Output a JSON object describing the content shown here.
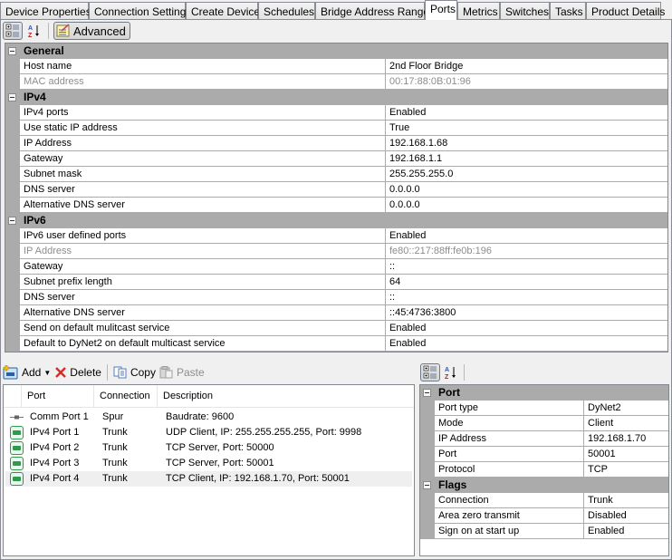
{
  "tabs": [
    {
      "label": "Device Properties",
      "active": false
    },
    {
      "label": "Connection Settings",
      "active": false
    },
    {
      "label": "Create Device",
      "active": false
    },
    {
      "label": "Schedules",
      "active": false
    },
    {
      "label": "Bridge Address Ranges",
      "active": false
    },
    {
      "label": "Ports",
      "active": true
    },
    {
      "label": "Metrics",
      "active": false
    },
    {
      "label": "Switches",
      "active": false
    },
    {
      "label": "Tasks",
      "active": false
    },
    {
      "label": "Product Details",
      "active": false
    }
  ],
  "top_toolbar": {
    "categorized_icon": "categorized-view-icon",
    "alphabetical_icon": "sort-az-icon",
    "advanced_label": "Advanced",
    "advanced_icon": "notepad-edit-icon",
    "advanced_pressed": true
  },
  "property_grid": {
    "categories": [
      {
        "name": "General",
        "properties": [
          {
            "name": "Host name",
            "value": "2nd Floor Bridge",
            "readonly": false
          },
          {
            "name": "MAC address",
            "value": "00:17:88:0B:01:96",
            "readonly": true
          }
        ]
      },
      {
        "name": "IPv4",
        "properties": [
          {
            "name": "IPv4 ports",
            "value": "Enabled",
            "readonly": false
          },
          {
            "name": "Use static IP address",
            "value": "True",
            "readonly": false
          },
          {
            "name": "IP Address",
            "value": "192.168.1.68",
            "readonly": false
          },
          {
            "name": "Gateway",
            "value": "192.168.1.1",
            "readonly": false
          },
          {
            "name": "Subnet mask",
            "value": "255.255.255.0",
            "readonly": false
          },
          {
            "name": "DNS server",
            "value": "0.0.0.0",
            "readonly": false
          },
          {
            "name": "Alternative DNS server",
            "value": "0.0.0.0",
            "readonly": false
          }
        ]
      },
      {
        "name": "IPv6",
        "properties": [
          {
            "name": "IPv6 user defined ports",
            "value": "Enabled",
            "readonly": false
          },
          {
            "name": "IP Address",
            "value": "fe80::217:88ff:fe0b:196",
            "readonly": true
          },
          {
            "name": "Gateway",
            "value": "::",
            "readonly": false
          },
          {
            "name": "Subnet prefix length",
            "value": "64",
            "readonly": false
          },
          {
            "name": "DNS server",
            "value": "::",
            "readonly": false
          },
          {
            "name": "Alternative DNS server",
            "value": "::45:4736:3800",
            "readonly": false
          },
          {
            "name": "Send on default mulitcast service",
            "value": "Enabled",
            "readonly": false
          },
          {
            "name": "Default to DyNet2 on default multicast service",
            "value": "Enabled",
            "readonly": false
          }
        ]
      }
    ]
  },
  "ports_toolbar": {
    "add_label": "Add",
    "delete_label": "Delete",
    "copy_label": "Copy",
    "paste_label": "Paste",
    "paste_disabled": true
  },
  "ports_list": {
    "columns": [
      "Port",
      "Connection",
      "Description"
    ],
    "rows": [
      {
        "icon": "serial-port-icon",
        "port": "Comm Port 1",
        "connection": "Spur",
        "description": "Baudrate: 9600",
        "selected": false
      },
      {
        "icon": "network-port-icon",
        "port": "IPv4 Port 1",
        "connection": "Trunk",
        "description": "UDP Client, IP: 255.255.255.255, Port: 9998",
        "selected": false
      },
      {
        "icon": "network-port-icon",
        "port": "IPv4 Port 2",
        "connection": "Trunk",
        "description": "TCP Server, Port: 50000",
        "selected": false
      },
      {
        "icon": "network-port-icon",
        "port": "IPv4 Port 3",
        "connection": "Trunk",
        "description": "TCP Server, Port: 50001",
        "selected": false
      },
      {
        "icon": "network-port-icon",
        "port": "IPv4 Port 4",
        "connection": "Trunk",
        "description": "TCP Client, IP: 192.168.1.70, Port: 50001",
        "selected": true
      }
    ]
  },
  "port_properties": {
    "categories": [
      {
        "name": "Port",
        "properties": [
          {
            "name": "Port type",
            "value": "DyNet2"
          },
          {
            "name": "Mode",
            "value": "Client"
          },
          {
            "name": "IP Address",
            "value": "192.168.1.70"
          },
          {
            "name": "Port",
            "value": "50001"
          },
          {
            "name": "Protocol",
            "value": "TCP"
          }
        ]
      },
      {
        "name": "Flags",
        "properties": [
          {
            "name": "Connection",
            "value": "Trunk"
          },
          {
            "name": "Area zero transmit",
            "value": "Disabled"
          },
          {
            "name": "Sign on at start up",
            "value": "Enabled"
          }
        ]
      }
    ]
  },
  "colors": {
    "category_band": "#ababab",
    "readonly_text": "#8d8d8d",
    "delete_red": "#d42b2b",
    "port_icon_green": "#2e9a4e",
    "selected_row": "#efefef"
  }
}
